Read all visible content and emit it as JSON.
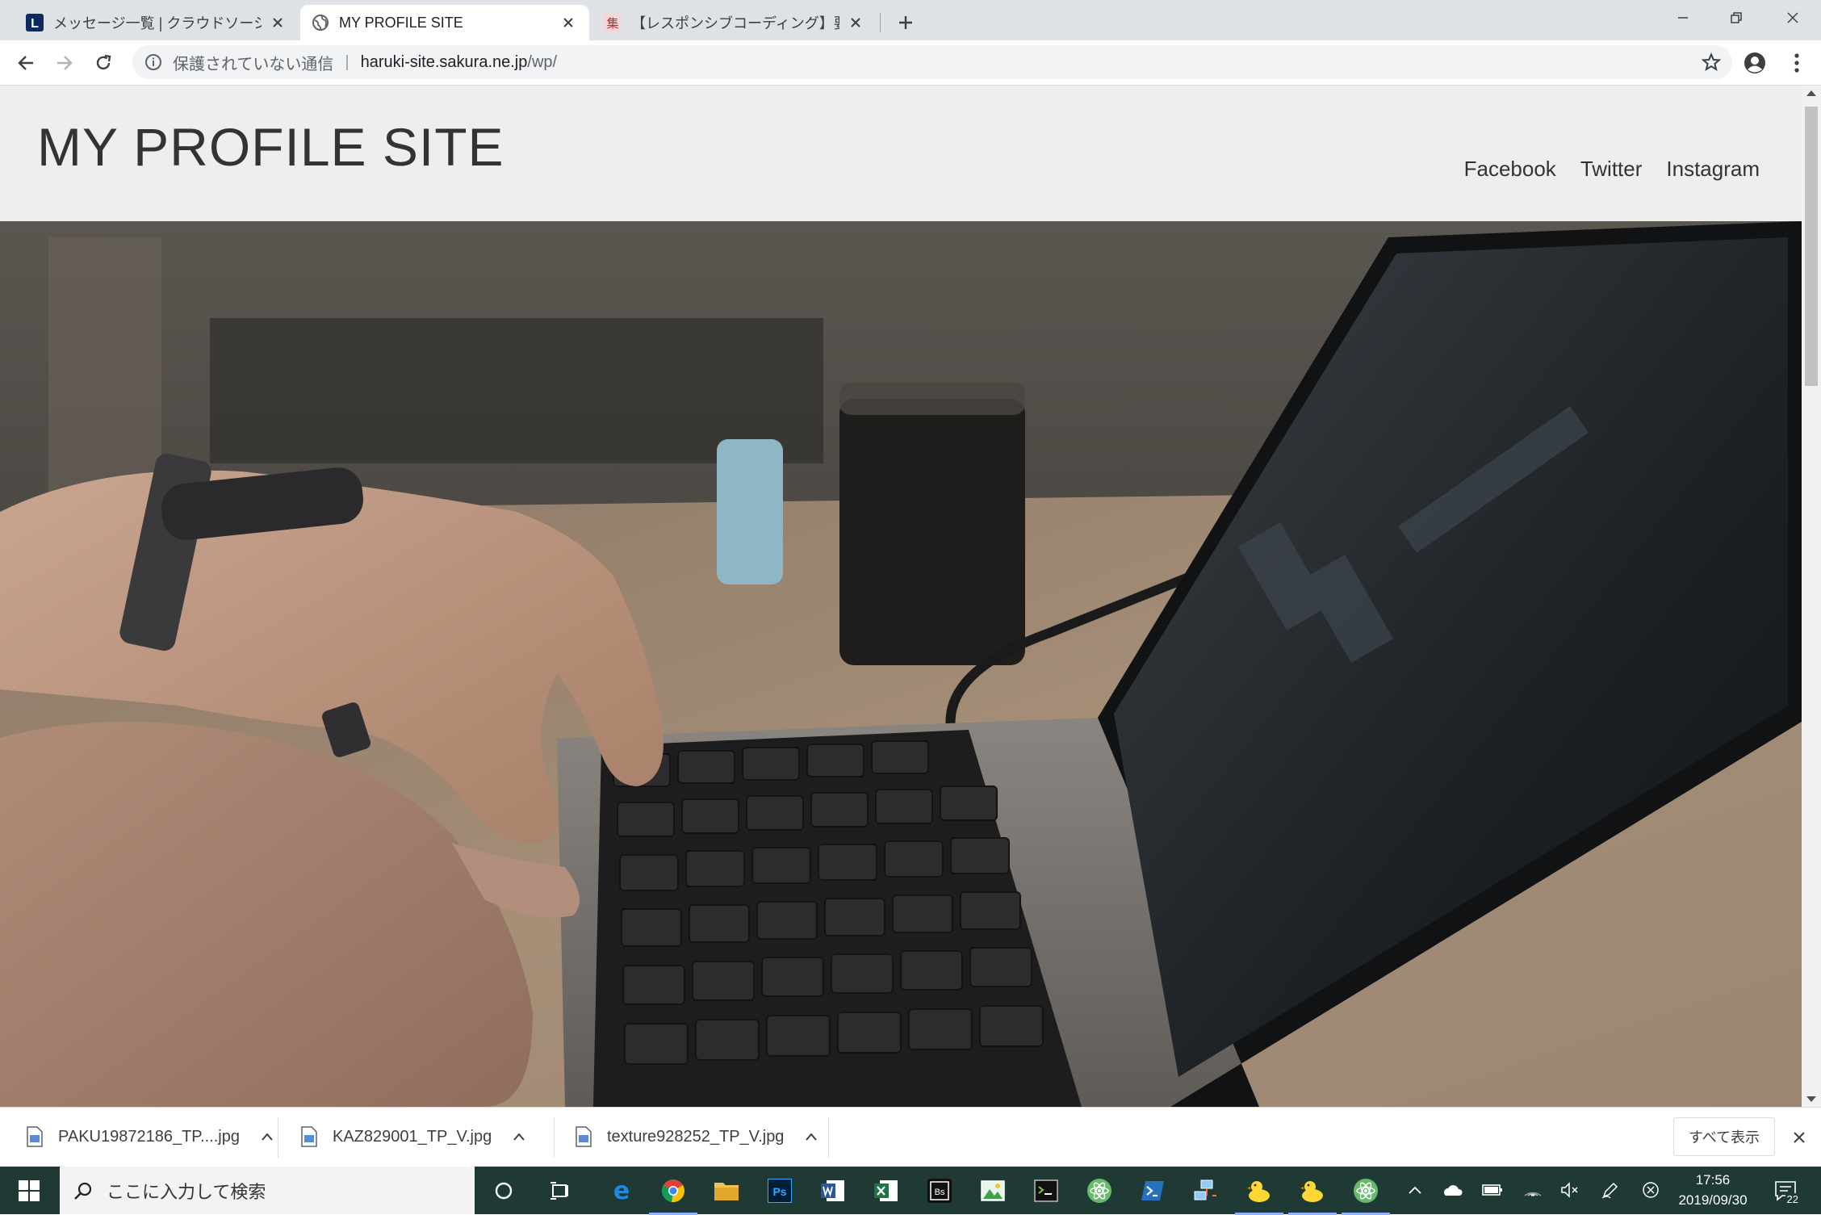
{
  "browser": {
    "tabs": [
      {
        "title": "メッセージ一覧 | クラウドソーシング「ラ",
        "favicon": "lancers-L-icon",
        "active": false
      },
      {
        "title": "MY PROFILE SITE",
        "favicon": "globe-icon",
        "active": true
      },
      {
        "title": "【レスポンシブコーディング】要素の横幅",
        "favicon": "kanji-seal-icon",
        "active": false
      }
    ],
    "favicon_letters": {
      "lancers": "L",
      "seal": "集"
    },
    "new_tab": "+",
    "address": {
      "security_label": "保護されていない通信",
      "host": "haruki-site.sakura.ne.jp",
      "path": "/wp/"
    }
  },
  "site": {
    "title": "MY PROFILE SITE",
    "nav": [
      "Facebook",
      "Twitter",
      "Instagram"
    ]
  },
  "downloads": {
    "items": [
      {
        "filename": "PAKU19872186_TP....jpg"
      },
      {
        "filename": "KAZ829001_TP_V.jpg"
      },
      {
        "filename": "texture928252_TP_V.jpg"
      }
    ],
    "show_all": "すべて表示"
  },
  "taskbar": {
    "search_placeholder": "ここに入力して検索",
    "app_letters": {
      "photoshop": "Ps",
      "bootstrap": "Bs"
    },
    "clock_time": "17:56",
    "clock_date": "2019/09/30",
    "notification_count": "22"
  },
  "colors": {
    "tabstrip": "#dee1e6",
    "site_header": "#eeeeee",
    "taskbar": "#1f3a34",
    "text_dark": "#333333"
  }
}
